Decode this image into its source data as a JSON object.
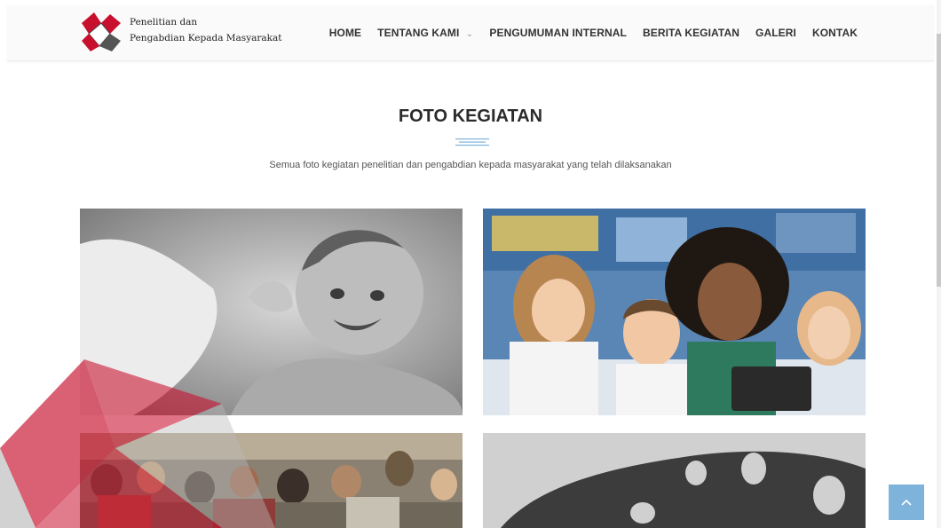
{
  "brand": {
    "line1": "Penelitian dan",
    "line2": "Pengabdian Kepada Masyarakat"
  },
  "nav": [
    {
      "label": "HOME",
      "has_dropdown": false
    },
    {
      "label": "TENTANG KAMI",
      "has_dropdown": true
    },
    {
      "label": "PENGUMUMAN INTERNAL",
      "has_dropdown": false
    },
    {
      "label": "BERITA KEGIATAN",
      "has_dropdown": false
    },
    {
      "label": "GALERI",
      "has_dropdown": false
    },
    {
      "label": "KONTAK",
      "has_dropdown": false
    }
  ],
  "section": {
    "title": "FOTO KEGIATAN",
    "subtitle": "Semua foto kegiatan penelitian dan pengabdian kepada masyarakat yang telah dilaksanakan"
  },
  "gallery": [
    {
      "subject": "laughing baby",
      "style": "grayscale"
    },
    {
      "subject": "teacher with children using a tablet",
      "style": "color"
    },
    {
      "subject": "people seated in a meeting",
      "style": "color"
    },
    {
      "subject": "dark abstract shape",
      "style": "grayscale"
    }
  ],
  "colors": {
    "accent_blue": "#7eb3dc",
    "logo_red": "#c8102e",
    "logo_gray": "#555555"
  },
  "icons": {
    "back_to_top": "chevron-up-icon",
    "dropdown": "chevron-down-icon"
  }
}
